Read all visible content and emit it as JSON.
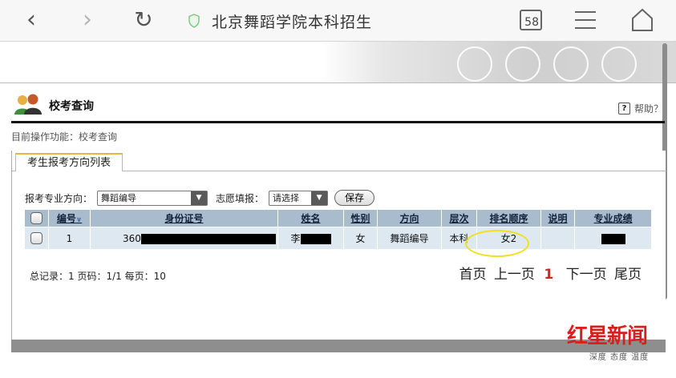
{
  "browser": {
    "url_title": "北京舞蹈学院本科招生",
    "tab_count": "58"
  },
  "page": {
    "title": "校考查询",
    "help": "帮助？",
    "breadcrumb": "目前操作功能：校考查询",
    "tab": "考生报考方向列表"
  },
  "filters": {
    "major_label": "报考专业方向：",
    "major_value": "舞蹈编导",
    "choice_label": "志愿填报：",
    "choice_value": "请选择",
    "save_label": "保存"
  },
  "table": {
    "headers": [
      "编号",
      "身份证号",
      "姓名",
      "性别",
      "方向",
      "层次",
      "排名顺序",
      "说明",
      "专业成绩"
    ],
    "rows": [
      {
        "no": "1",
        "id": "360",
        "name": "李",
        "gender": "女",
        "direction": "舞蹈编导",
        "level": "本科",
        "rank": "女2",
        "note": "",
        "score": ""
      }
    ]
  },
  "summary": {
    "records": "总记录：1 页码：1/1 每页：10"
  },
  "pager": {
    "first": "首页",
    "prev": "上一页",
    "current": "1",
    "next": "下一页",
    "last": "尾页"
  },
  "watermark": {
    "logo": "红星新闻",
    "slogan": "深度 态度 温度"
  },
  "colors": {
    "header_bg": "#a8bccd",
    "row_bg": "#dde8f0",
    "pager_current": "#d0271d",
    "highlight_circle": "#f2e01a",
    "tab_accent": "#e6b640"
  }
}
